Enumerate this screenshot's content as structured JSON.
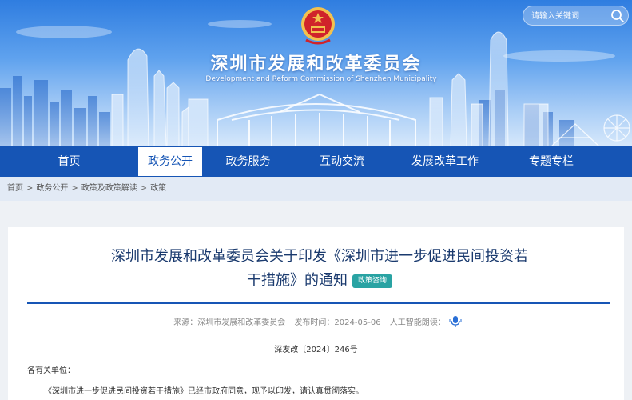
{
  "header": {
    "title": "深圳市发展和改革委员会",
    "subtitle": "Development and Reform Commission of Shenzhen Municipality",
    "emblem_icon": "national-emblem-icon",
    "search": {
      "placeholder": "请输入关键词",
      "icon": "search-icon"
    }
  },
  "nav": {
    "items": [
      {
        "label": "首页"
      },
      {
        "label": "政务公开"
      },
      {
        "label": "政务服务"
      },
      {
        "label": "互动交流"
      },
      {
        "label": "发展改革工作"
      },
      {
        "label": "专题专栏"
      }
    ],
    "active_index": 1
  },
  "breadcrumb": [
    "首页",
    "政务公开",
    "政策及政策解读",
    "政策"
  ],
  "article": {
    "title_line1": "深圳市发展和改革委员会关于印发《深圳市进一步促进民间投资若",
    "title_line2": "干措施》的通知",
    "badge": "政策咨询",
    "source": "来源：深圳市发展和改革委员会",
    "publish_time": "发布时间：2024-05-06",
    "ai_read": "人工智能朗读：",
    "doc_number": "深发改〔2024〕246号",
    "para1": "各有关单位：",
    "para2": "《深圳市进一步促进民间投资若干措施》已经市政府同意，现予以印发，请认真贯彻落实。"
  },
  "colors": {
    "nav_bg": "#1655b5",
    "title_color": "#1a3a6e",
    "badge_bg": "#29a3a3",
    "breadcrumb_bg": "#e2eaf5"
  }
}
